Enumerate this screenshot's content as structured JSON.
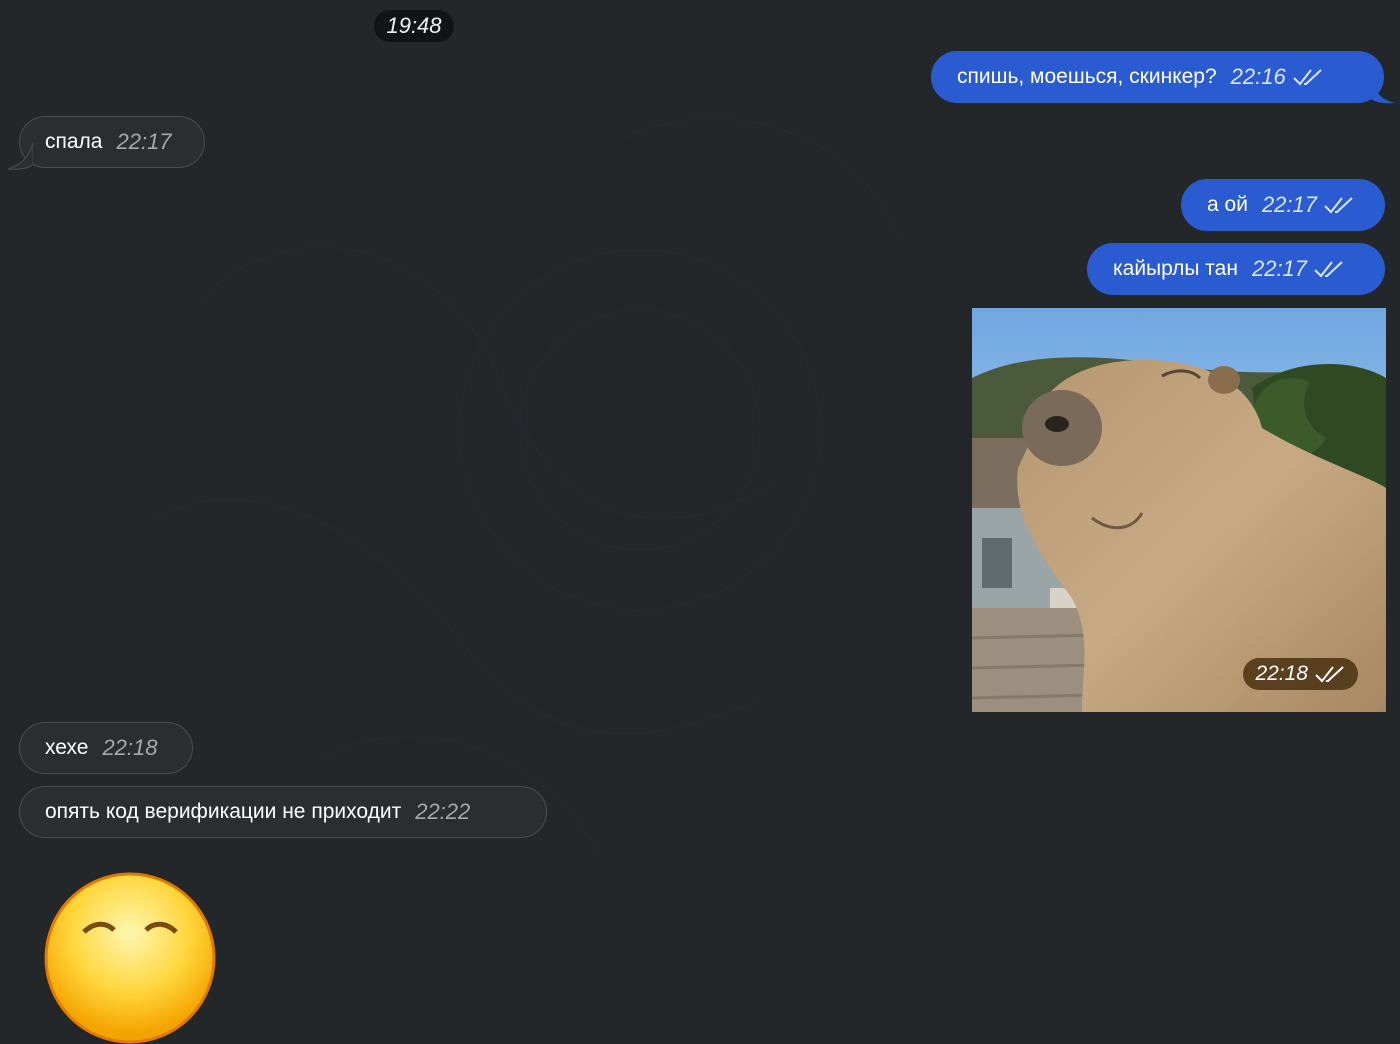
{
  "chat": {
    "date_divider": "19:48",
    "messages": [
      {
        "direction": "out",
        "text": "спишь, моешься, скинкер?",
        "time": "22:16",
        "status": "read"
      },
      {
        "direction": "in",
        "text": "спала",
        "time": "22:17"
      },
      {
        "direction": "out",
        "text": "а ой",
        "time": "22:17",
        "status": "read"
      },
      {
        "direction": "out",
        "text": "кайырлы тан",
        "time": "22:17",
        "status": "read"
      },
      {
        "direction": "out",
        "type": "photo",
        "time": "22:18",
        "status": "read"
      },
      {
        "direction": "in",
        "text": "хехе",
        "time": "22:18"
      },
      {
        "direction": "in",
        "text": "опять код верификации не приходит",
        "time": "22:22"
      },
      {
        "direction": "in",
        "type": "sticker",
        "icon": "grinning-emoji-icon"
      }
    ]
  },
  "colors": {
    "background": "#23272a",
    "outgoing_bubble": "#2a5bd1",
    "incoming_bubble": "#2b2e31"
  },
  "icons": {
    "read_status": "double-check-icon"
  }
}
